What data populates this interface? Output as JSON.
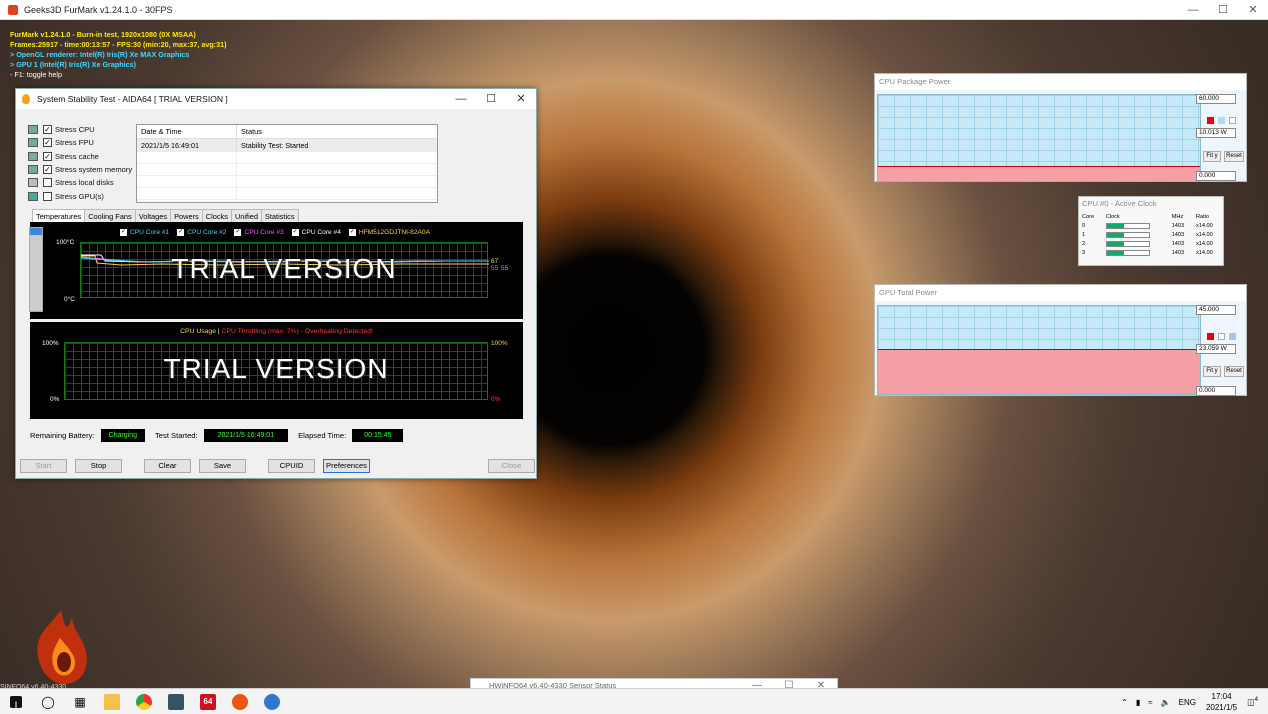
{
  "furmark": {
    "title": "Geeks3D FurMark v1.24.1.0 - 30FPS",
    "overlay": [
      {
        "text": "FurMark v1.24.1.0 - Burn-in test, 1920x1080 (0X MSAA)",
        "color": "yellow"
      },
      {
        "text": "Frames:25917 - time:00:13:57 - FPS:30 (min:20, max:37, avg:31)",
        "color": "yellow"
      },
      {
        "text": "> OpenGL renderer: Intel(R) Iris(R) Xe MAX Graphics",
        "color": "cyan"
      },
      {
        "text": "> GPU 1 (Intel(R) Iris(R) Xe Graphics)",
        "color": "cyan"
      },
      {
        "text": "- F1: toggle help",
        "color": "white"
      }
    ]
  },
  "aida": {
    "title": "System Stability Test - AIDA64  [ TRIAL VERSION ]",
    "stress": [
      {
        "label": "Stress CPU",
        "checked": true
      },
      {
        "label": "Stress FPU",
        "checked": true
      },
      {
        "label": "Stress cache",
        "checked": true
      },
      {
        "label": "Stress system memory",
        "checked": true
      },
      {
        "label": "Stress local disks",
        "checked": false
      },
      {
        "label": "Stress GPU(s)",
        "checked": false
      }
    ],
    "log": {
      "headers": [
        "Date & Time",
        "Status"
      ],
      "rows": [
        [
          "2021/1/5 16:49:01",
          "Stability Test: Started"
        ]
      ]
    },
    "tabs": [
      "Temperatures",
      "Cooling Fans",
      "Voltages",
      "Powers",
      "Clocks",
      "Unified",
      "Statistics"
    ],
    "temp_chart": {
      "legend": [
        {
          "label": "CPU Core #1",
          "color": "#3fd9ff"
        },
        {
          "label": "CPU Core #2",
          "color": "#3fd9ff"
        },
        {
          "label": "CPU Core #3",
          "color": "#ff55ff"
        },
        {
          "label": "CPU Core #4",
          "color": "#ffffff"
        },
        {
          "label": "HFM512GDJTNI-82A0A",
          "color": "#ffd24a"
        }
      ],
      "ymax": "100°C",
      "ymin": "0°C",
      "right_values": [
        "67",
        "55",
        "55"
      ],
      "watermark": "TRIAL VERSION"
    },
    "usage_chart": {
      "label_a": "CPU Usage",
      "sep": "|",
      "label_b": "CPU Throttling (max: 7%) - Overheating Detected!",
      "ymax_left": "100%",
      "ymin_left": "0%",
      "ymax_right": "100%",
      "ymin_right": "0%",
      "watermark": "TRIAL VERSION"
    },
    "status": {
      "battery_label": "Remaining Battery:",
      "battery": "Charging",
      "started_label": "Test Started:",
      "started": "2021/1/5 16:49:01",
      "elapsed_label": "Elapsed Time:",
      "elapsed": "00:15:45"
    },
    "buttons": {
      "start": "Start",
      "stop": "Stop",
      "clear": "Clear",
      "save": "Save",
      "cpuid": "CPUID",
      "preferences": "Preferences",
      "close": "Close"
    }
  },
  "cpu_power": {
    "title": "CPU Package Power",
    "max": "60.000",
    "current": "10.013 W",
    "min": "0.000",
    "fit": "Fit y",
    "reset": "Reset",
    "level_fraction": 0.17
  },
  "gpu_power": {
    "title": "GPU Total Power",
    "max": "45.000",
    "current": "23.059 W",
    "min": "0.000",
    "fit": "Fit y",
    "reset": "Reset",
    "level_fraction": 0.51
  },
  "clock": {
    "title": "CPU #0 - Active Clock",
    "headers": [
      "Core",
      "Clock",
      "MHz",
      "Ratio"
    ],
    "rows": [
      [
        "0",
        "1403",
        "x14.00"
      ],
      [
        "1",
        "1403",
        "x14.00"
      ],
      [
        "2",
        "1403",
        "x14.00"
      ],
      [
        "3",
        "1403",
        "x14.00"
      ]
    ]
  },
  "hwinfo": {
    "title": "HWiNFO64 v6.40-4330 Sensor Status"
  },
  "left_scrap": "SINFO64 v6.40-4330",
  "taskbar": {
    "lang": "ENG",
    "time": "17:04",
    "date": "2021/1/5",
    "notif": "4"
  }
}
